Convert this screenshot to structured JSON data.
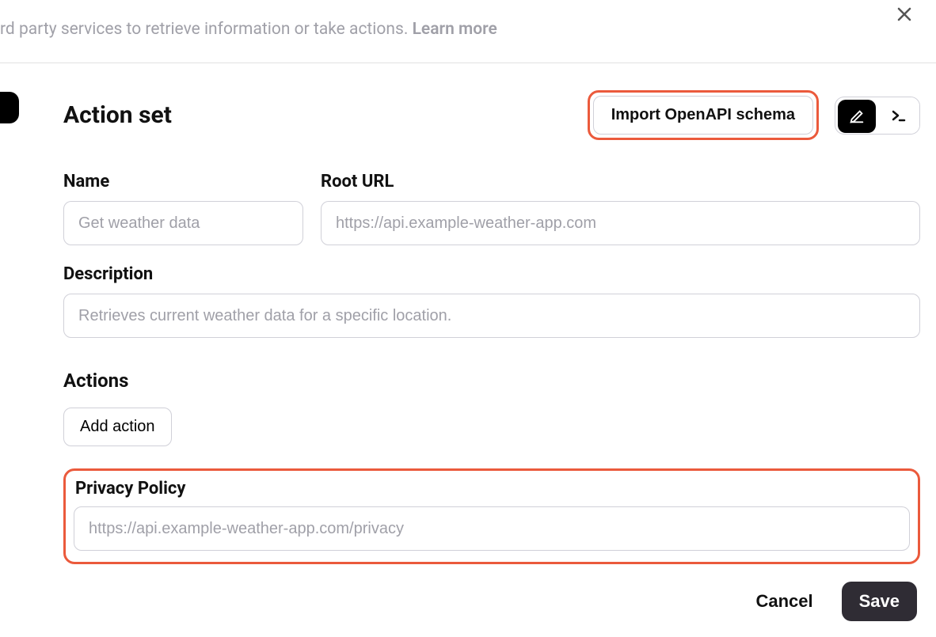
{
  "top": {
    "blurb": "rd party services to retrieve information or take actions. ",
    "learn_more": "Learn more"
  },
  "header": {
    "title": "Action set",
    "import_label": "Import OpenAPI schema"
  },
  "fields": {
    "name": {
      "label": "Name",
      "placeholder": "Get weather data",
      "value": ""
    },
    "root_url": {
      "label": "Root URL",
      "placeholder": "https://api.example-weather-app.com",
      "value": ""
    },
    "description": {
      "label": "Description",
      "placeholder": "Retrieves current weather data for a specific location.",
      "value": ""
    }
  },
  "actions": {
    "title": "Actions",
    "add_label": "Add action"
  },
  "privacy": {
    "label": "Privacy Policy",
    "placeholder": "https://api.example-weather-app.com/privacy",
    "value": ""
  },
  "footer": {
    "cancel": "Cancel",
    "save": "Save"
  }
}
